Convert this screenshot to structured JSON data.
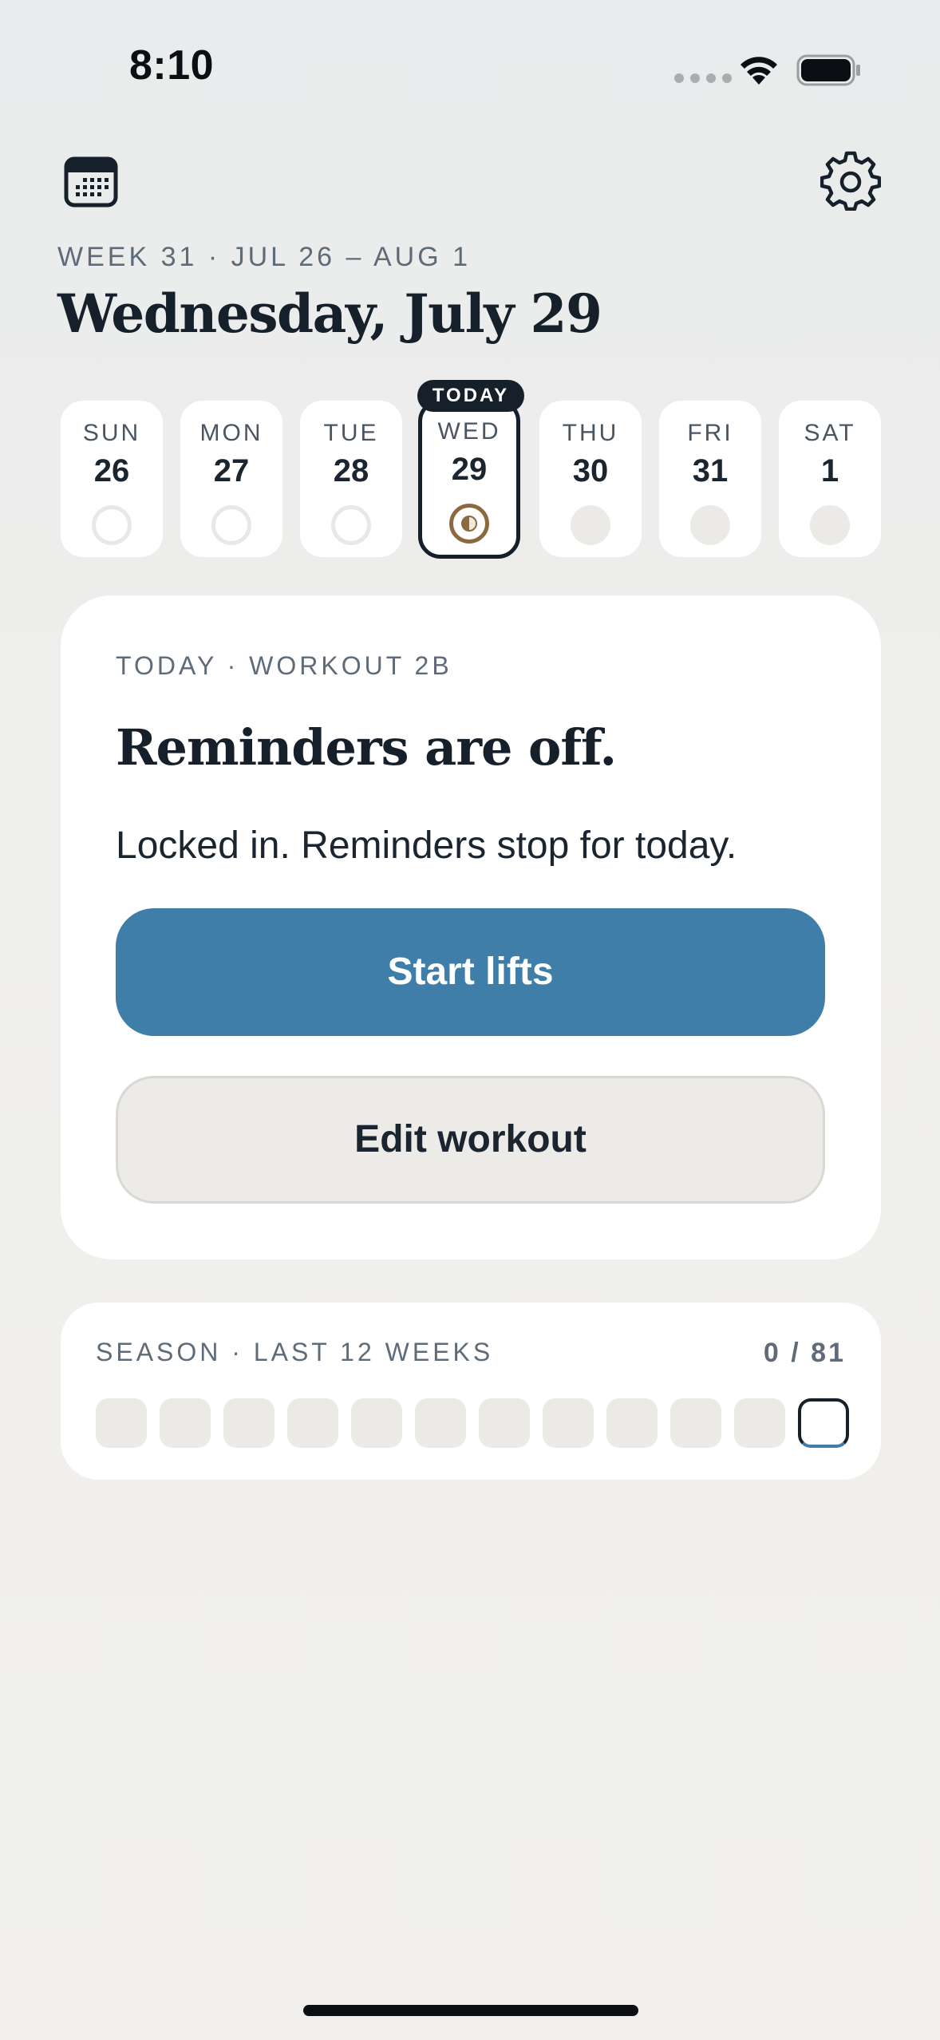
{
  "status": {
    "time": "8:10"
  },
  "header": {
    "week_label": "WEEK 31 · JUL 26 – AUG 1",
    "day_title": "Wednesday, July 29"
  },
  "week": {
    "today_badge": "TODAY",
    "days": [
      {
        "name": "SUN",
        "num": "26",
        "state": "past"
      },
      {
        "name": "MON",
        "num": "27",
        "state": "past"
      },
      {
        "name": "TUE",
        "num": "28",
        "state": "past"
      },
      {
        "name": "WED",
        "num": "29",
        "state": "today"
      },
      {
        "name": "THU",
        "num": "30",
        "state": "future"
      },
      {
        "name": "FRI",
        "num": "31",
        "state": "future"
      },
      {
        "name": "SAT",
        "num": "1",
        "state": "future"
      }
    ]
  },
  "card": {
    "eyebrow": "TODAY · WORKOUT 2B",
    "title": "Reminders are off.",
    "subtitle": "Locked in. Reminders stop for today.",
    "primary_label": "Start lifts",
    "secondary_label": "Edit workout"
  },
  "season": {
    "label": "SEASON · LAST 12 WEEKS",
    "count": "0 / 81",
    "weeks_total": 12,
    "current_week_index": 11
  },
  "colors": {
    "accent": "#3f7ea8",
    "ink": "#16202b",
    "today_ring": "#8c6a3f"
  }
}
